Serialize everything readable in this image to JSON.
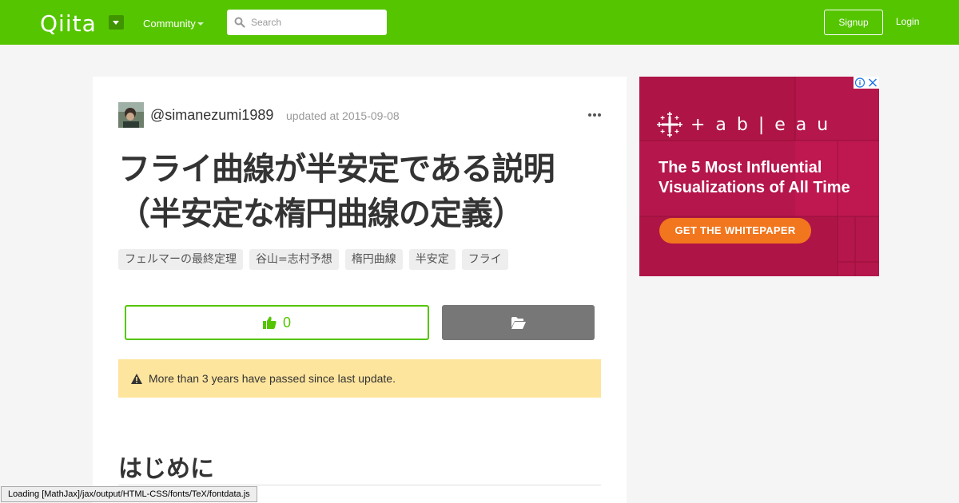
{
  "header": {
    "logo_text": "Qiita",
    "community_label": "Community",
    "search_placeholder": "Search",
    "signup_label": "Signup",
    "login_label": "Login",
    "brand_color": "#55c500"
  },
  "article": {
    "author": "@simanezumi1989",
    "updated": "updated at 2015-09-08",
    "title": "フライ曲線が半安定である説明（半安定な楕円曲線の定義）",
    "tags": [
      "フェルマーの最終定理",
      "谷山=志村予想",
      "楕円曲線",
      "半安定",
      "フライ"
    ],
    "like_count": "0",
    "alert_text": "More than 3 years have passed since last update.",
    "first_heading": "はじめに"
  },
  "ad": {
    "logo_text": "+ a b | e a u",
    "headline": "The 5 Most Influential Visualizations of All Time",
    "cta": "GET THE WHITEPAPER",
    "background_color": "#b5164b",
    "cta_color": "#f2761d"
  },
  "status_bar": {
    "text": "Loading [MathJax]/jax/output/HTML-CSS/fonts/TeX/fontdata.js"
  }
}
